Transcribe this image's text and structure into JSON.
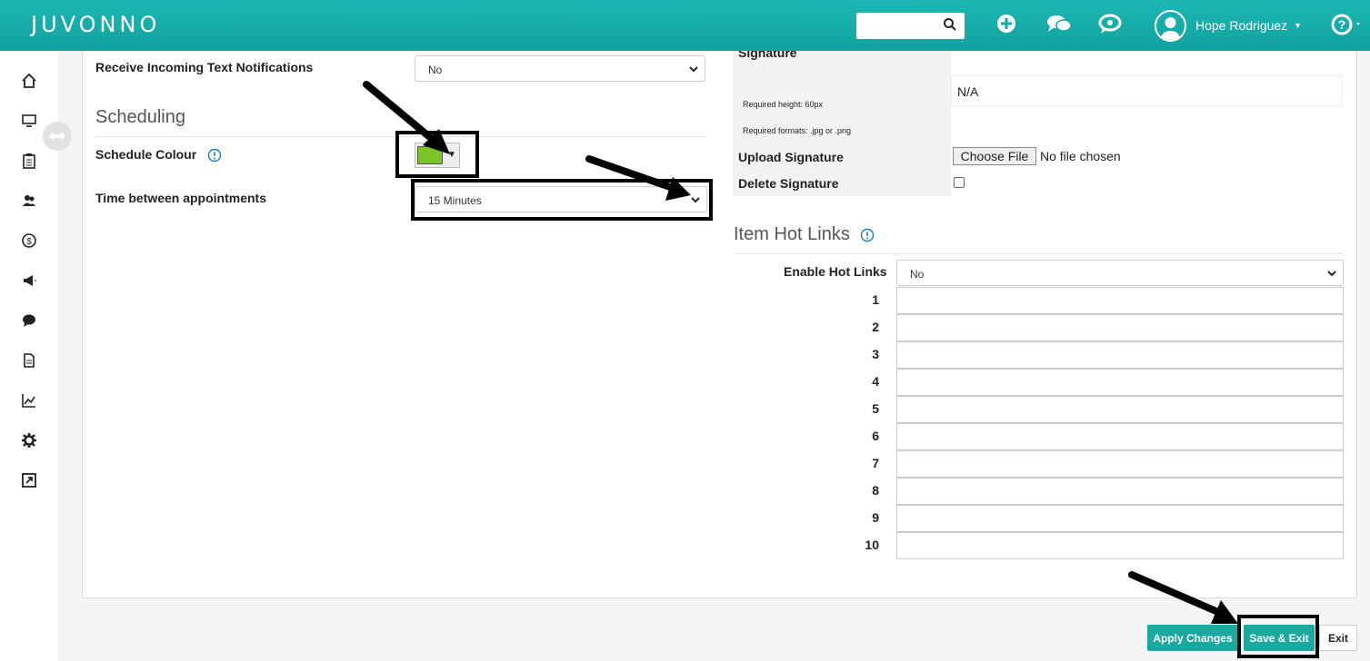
{
  "header": {
    "logo": "JUVONNO",
    "search_placeholder": "",
    "user_name": "Hope Rodriguez",
    "icons": [
      "search-icon",
      "plus-circle-icon",
      "chat-bubbles-icon",
      "chat-refresh-icon",
      "user-avatar-icon",
      "help-icon"
    ]
  },
  "sidebar": {
    "items": [
      "home-icon",
      "monitor-icon",
      "clipboard-icon",
      "users-icon",
      "dollar-icon",
      "megaphone-icon",
      "comment-icon",
      "document-icon",
      "chart-icon",
      "gear-icon",
      "external-link-icon"
    ]
  },
  "left": {
    "receive_text_label": "Receive Incoming Text Notifications",
    "receive_text_value": "No",
    "scheduling_title": "Scheduling",
    "schedule_colour_label": "Schedule Colour",
    "schedule_colour": "#7dc42b",
    "time_between_label": "Time between appointments",
    "time_between_value": "15 Minutes"
  },
  "right": {
    "signature_label": "Signature",
    "signature_value": "N/A",
    "required_height": "Required height: 60px",
    "required_formats": "Required formats: .jpg or .png",
    "upload_label": "Upload Signature",
    "choose_file": "Choose File",
    "no_file": "No file chosen",
    "delete_label": "Delete Signature",
    "hot_links_title": "Item Hot Links",
    "enable_label": "Enable Hot Links",
    "enable_value": "No",
    "link_numbers": [
      "1",
      "2",
      "3",
      "4",
      "5",
      "6",
      "7",
      "8",
      "9",
      "10"
    ]
  },
  "footer": {
    "apply": "Apply Changes",
    "save_exit": "Save & Exit",
    "exit": "Exit"
  },
  "colors": {
    "brand": "#14aaa6",
    "accent": "#1aa89f"
  }
}
